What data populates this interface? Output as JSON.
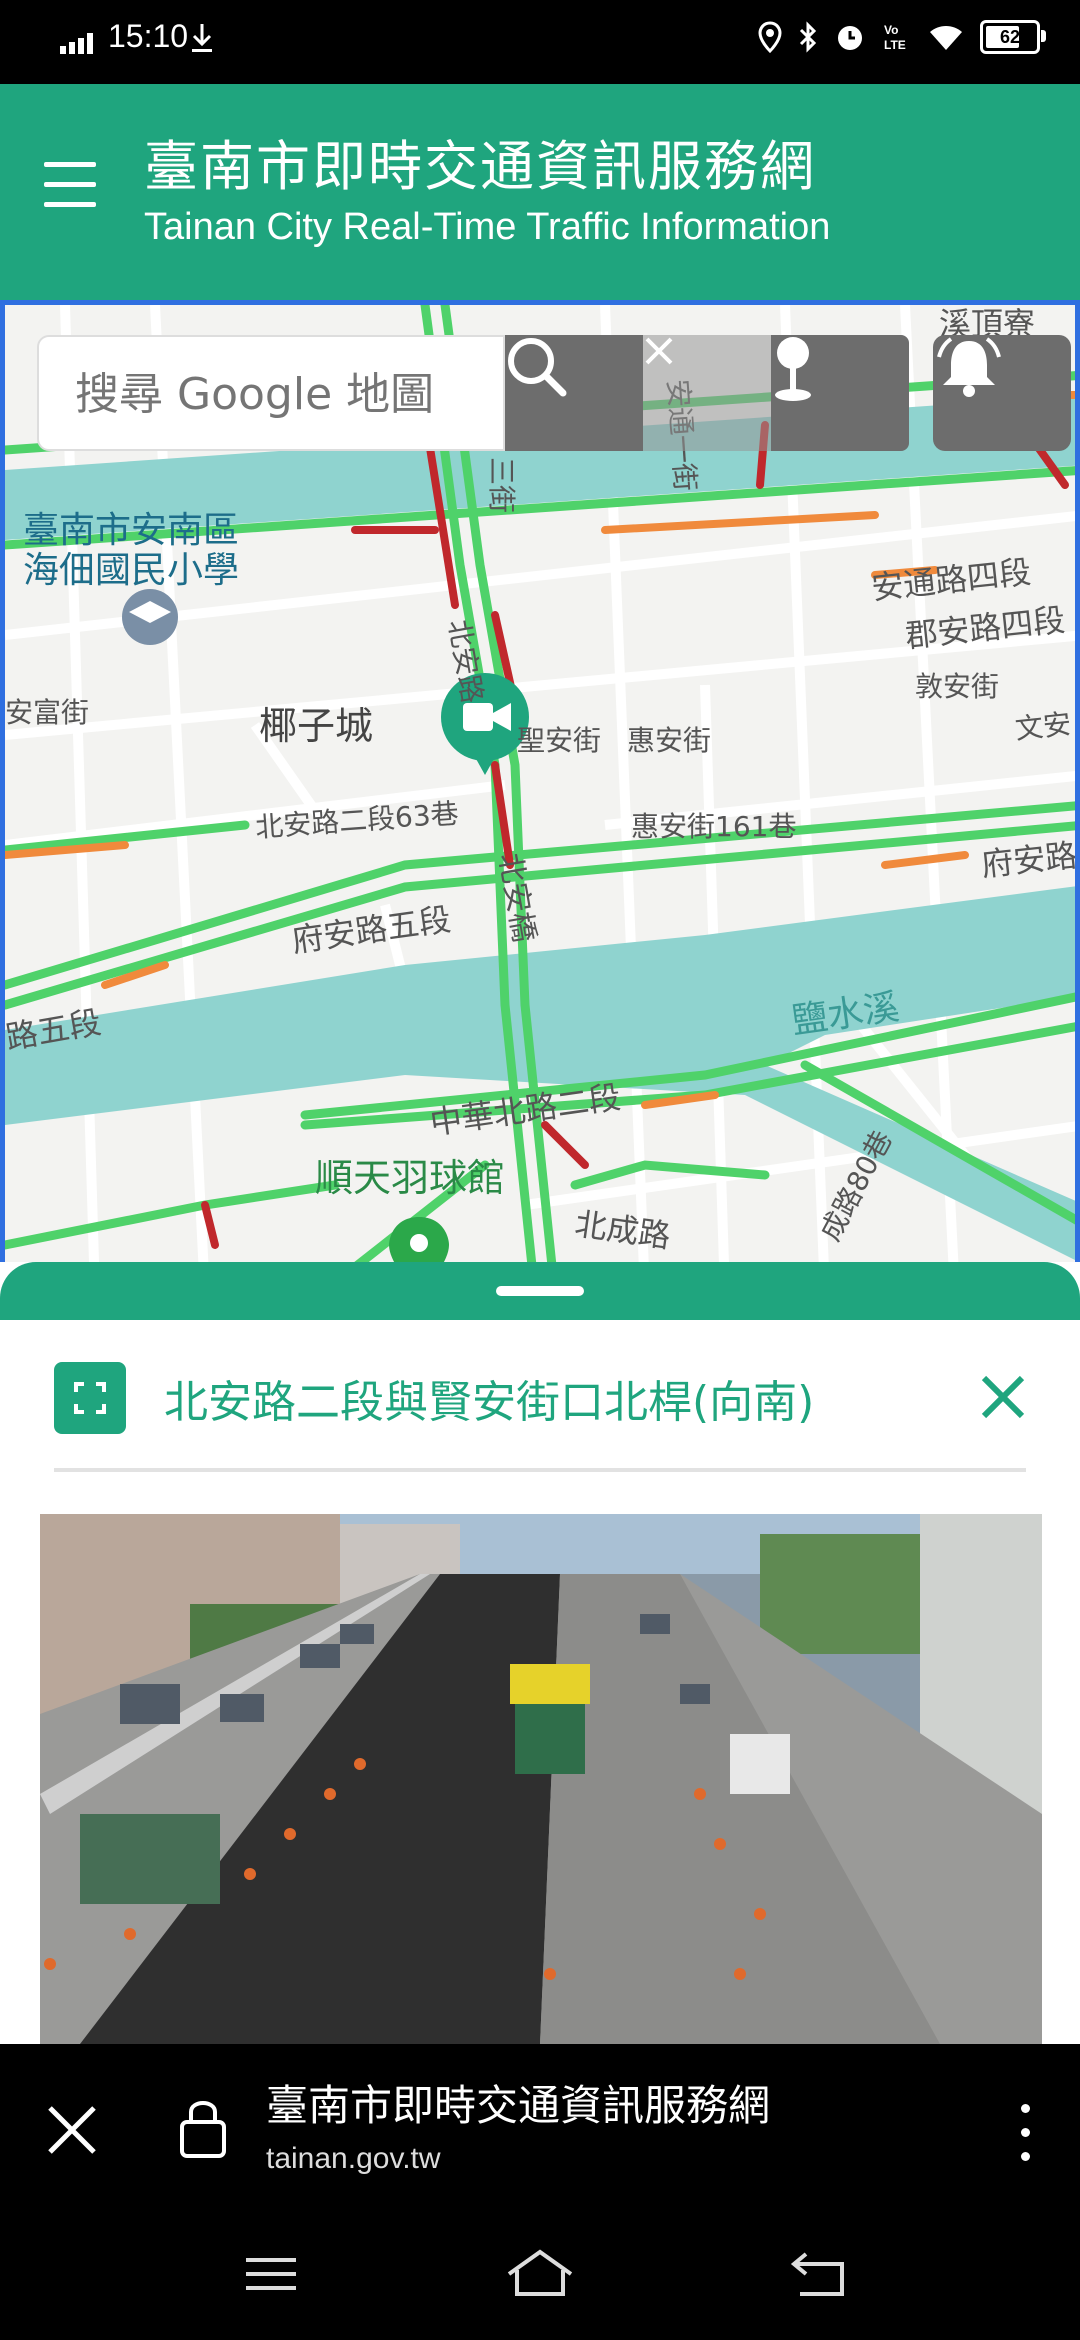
{
  "status_bar": {
    "time": "15:10",
    "battery": "62",
    "icons": [
      "signal-icon",
      "download-icon",
      "location-icon",
      "bluetooth-icon",
      "alarm-icon",
      "volte-icon",
      "wifi-icon",
      "battery-icon"
    ]
  },
  "header": {
    "title_zh": "臺南市即時交通資訊服務網",
    "title_en": "Tainan City Real-Time Traffic Information"
  },
  "map": {
    "search_placeholder": "搜尋 Google 地圖",
    "labels": {
      "district": "臺南市安南區",
      "school": "海佃國民小學",
      "village": "椰子城",
      "road1": "北安路二段63巷",
      "road2": "府安路五段",
      "road3": "北安橋",
      "road4": "中華北路二段",
      "poi": "順天羽球館",
      "road5": "北成路",
      "road6": "安通路四段",
      "road7": "郡安路四段",
      "road8": "敦安街",
      "road9": "惠安街",
      "road10": "惠安街161巷",
      "road11": "府安路",
      "river": "鹽水溪",
      "road12": "安富街",
      "road13": "路五段",
      "road14": "三街",
      "road15": "安通一街",
      "road16": "文安",
      "road17": "溪頂寮",
      "road18": "成路80巷",
      "road19": "聖安街",
      "road20": "北安路"
    }
  },
  "sheet": {
    "camera_title": "北安路二段與賢安街口北桿(向南)"
  },
  "browser_bar": {
    "title": "臺南市即時交通資訊服務網",
    "url": "tainan.gov.tw"
  },
  "colors": {
    "brand_green": "#1fa57e",
    "traffic_green": "#4fd26a",
    "traffic_red": "#c0282c",
    "traffic_orange": "#f08a3c",
    "river": "#8fd3cf"
  }
}
